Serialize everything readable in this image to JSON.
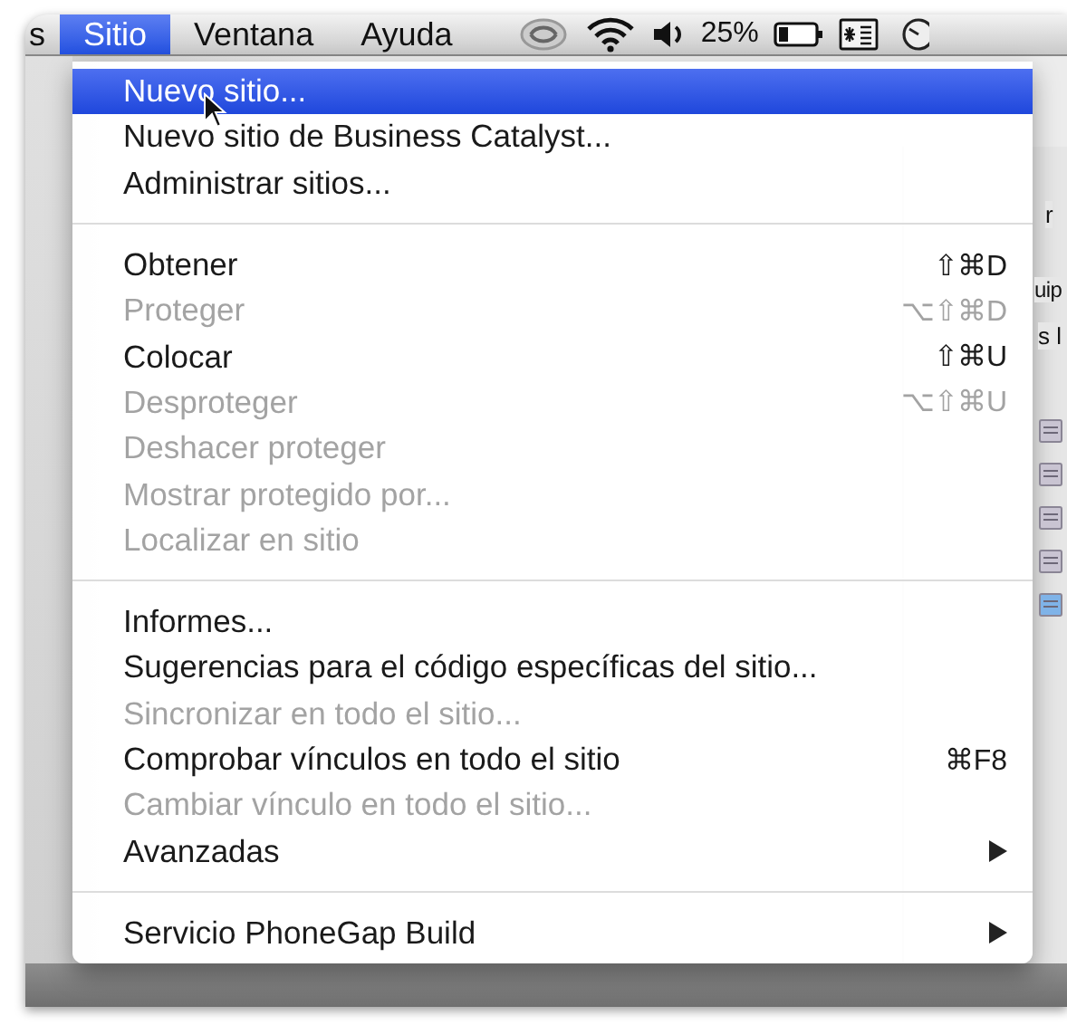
{
  "menubar": {
    "items": [
      {
        "label": "s",
        "selected": false
      },
      {
        "label": "Sitio",
        "selected": true
      },
      {
        "label": "Ventana",
        "selected": false
      },
      {
        "label": "Ayuda",
        "selected": false
      }
    ],
    "battery_percent": "25%"
  },
  "background_window": {
    "texts": [
      "r",
      "uip",
      "s l"
    ]
  },
  "menu": {
    "items": [
      {
        "kind": "item",
        "label": "Nuevo sitio...",
        "selected": true,
        "disabled": false
      },
      {
        "kind": "item",
        "label": "Nuevo sitio de Business Catalyst...",
        "selected": false,
        "disabled": false
      },
      {
        "kind": "item",
        "label": "Administrar sitios...",
        "selected": false,
        "disabled": false
      },
      {
        "kind": "separator"
      },
      {
        "kind": "item",
        "label": "Obtener",
        "shortcut": "⇧⌘D",
        "selected": false,
        "disabled": false
      },
      {
        "kind": "item",
        "label": "Proteger",
        "shortcut": "⌥⇧⌘D",
        "selected": false,
        "disabled": true
      },
      {
        "kind": "item",
        "label": "Colocar",
        "shortcut": "⇧⌘U",
        "selected": false,
        "disabled": false
      },
      {
        "kind": "item",
        "label": "Desproteger",
        "shortcut": "⌥⇧⌘U",
        "selected": false,
        "disabled": true
      },
      {
        "kind": "item",
        "label": "Deshacer proteger",
        "selected": false,
        "disabled": true
      },
      {
        "kind": "item",
        "label": "Mostrar protegido por...",
        "selected": false,
        "disabled": true
      },
      {
        "kind": "item",
        "label": "Localizar en sitio",
        "selected": false,
        "disabled": true
      },
      {
        "kind": "separator"
      },
      {
        "kind": "item",
        "label": "Informes...",
        "selected": false,
        "disabled": false
      },
      {
        "kind": "item",
        "label": "Sugerencias para el código específicas del sitio...",
        "selected": false,
        "disabled": false
      },
      {
        "kind": "item",
        "label": "Sincronizar en todo el sitio...",
        "selected": false,
        "disabled": true
      },
      {
        "kind": "item",
        "label": "Comprobar vínculos en todo el sitio",
        "shortcut": "⌘F8",
        "selected": false,
        "disabled": false
      },
      {
        "kind": "item",
        "label": "Cambiar vínculo en todo el sitio...",
        "selected": false,
        "disabled": true
      },
      {
        "kind": "submenu",
        "label": "Avanzadas",
        "selected": false,
        "disabled": false
      },
      {
        "kind": "separator"
      },
      {
        "kind": "submenu",
        "label": "Servicio PhoneGap Build",
        "selected": false,
        "disabled": false
      }
    ]
  }
}
